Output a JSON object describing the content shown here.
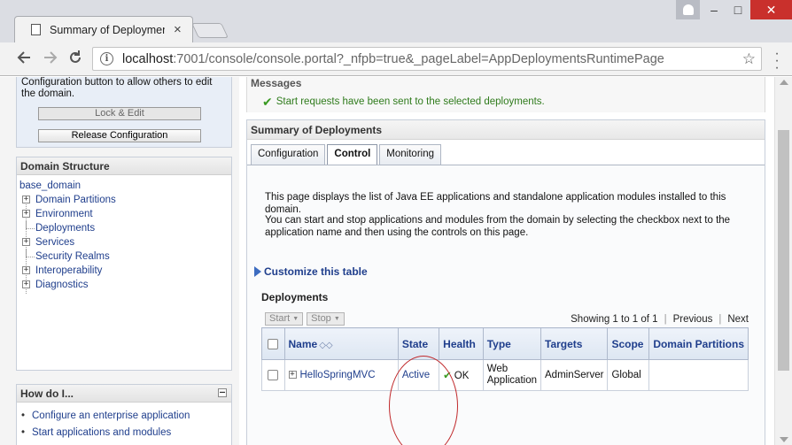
{
  "browser": {
    "tab_title": "Summary of Deployment",
    "tab_close": "×",
    "window_controls": {
      "minimize": "–",
      "maximize": "□",
      "close": "✕"
    },
    "url_host": "localhost",
    "url_rest": ":7001/console/console.portal?_nfpb=true&_pageLabel=AppDeploymentsRuntimePage",
    "icons": [
      "back-icon",
      "forward-icon",
      "reload-icon",
      "info-icon",
      "star-icon",
      "menu-icon",
      "user-icon"
    ]
  },
  "change_center": {
    "text": "Configuration button to allow others to edit the domain.",
    "lock_label": "Lock & Edit",
    "release_label": "Release Configuration"
  },
  "domain_structure": {
    "title": "Domain Structure",
    "root": "base_domain",
    "items": [
      {
        "label": "Domain Partitions",
        "expandable": true
      },
      {
        "label": "Environment",
        "expandable": true
      },
      {
        "label": "Deployments",
        "expandable": false
      },
      {
        "label": "Services",
        "expandable": true
      },
      {
        "label": "Security Realms",
        "expandable": false
      },
      {
        "label": "Interoperability",
        "expandable": true
      },
      {
        "label": "Diagnostics",
        "expandable": true
      }
    ]
  },
  "how_do_i": {
    "title": "How do I...",
    "items": [
      "Configure an enterprise application",
      "Start applications and modules"
    ]
  },
  "messages": {
    "title": "Messages",
    "text": "Start requests have been sent to the selected deployments."
  },
  "summary": {
    "title": "Summary of Deployments",
    "tabs": [
      "Configuration",
      "Control",
      "Monitoring"
    ],
    "active_tab": "Control",
    "desc1": "This page displays the list of Java EE applications and standalone application modules installed to this domain.",
    "desc2": "You can start and stop applications and modules from the domain by selecting the checkbox next to the application name and then using the controls on this page.",
    "customize": "Customize this table",
    "deployments_title": "Deployments",
    "start_label": "Start",
    "stop_label": "Stop",
    "pager": {
      "showing": "Showing 1 to 1 of 1",
      "previous": "Previous",
      "next": "Next"
    },
    "columns": [
      "Name",
      "State",
      "Health",
      "Type",
      "Targets",
      "Scope",
      "Domain Partitions"
    ],
    "rows": [
      {
        "name": "HelloSpringMVC",
        "state": "Active",
        "health": "OK",
        "type": "Web Application",
        "targets": "AdminServer",
        "scope": "Global",
        "partitions": ""
      }
    ]
  },
  "colors": {
    "link": "#1f3e8c",
    "success": "#2f7b1c",
    "annotation": "#c0292b"
  }
}
